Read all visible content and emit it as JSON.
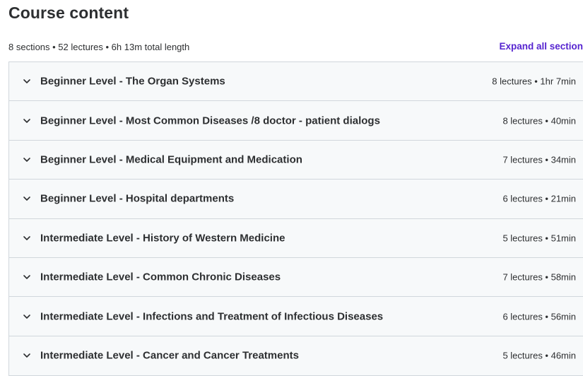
{
  "header": {
    "title": "Course content",
    "summary": "8 sections • 52 lectures • 6h 13m total length",
    "expand_label": "Expand all section"
  },
  "sections": [
    {
      "title": "Beginner Level - The Organ Systems",
      "meta": "8 lectures • 1hr 7min"
    },
    {
      "title": "Beginner Level - Most Common Diseases /8 doctor - patient dialogs",
      "meta": "8 lectures • 40min"
    },
    {
      "title": "Beginner Level - Medical Equipment and Medication",
      "meta": "7 lectures • 34min"
    },
    {
      "title": "Beginner Level - Hospital departments",
      "meta": "6 lectures • 21min"
    },
    {
      "title": "Intermediate Level - History of Western Medicine",
      "meta": "5 lectures • 51min"
    },
    {
      "title": "Intermediate Level - Common Chronic Diseases",
      "meta": "7 lectures • 58min"
    },
    {
      "title": "Intermediate Level - Infections and Treatment of Infectious Diseases",
      "meta": "6 lectures • 56min"
    },
    {
      "title": "Intermediate Level - Cancer and Cancer Treatments",
      "meta": "5 lectures • 46min"
    }
  ],
  "icons": {
    "section_toggle": "chevron-down-icon"
  },
  "colors": {
    "accent": "#5624d0",
    "section_bg": "#f7f9fa",
    "border": "#d1d7dc",
    "text": "#2d2f31"
  }
}
